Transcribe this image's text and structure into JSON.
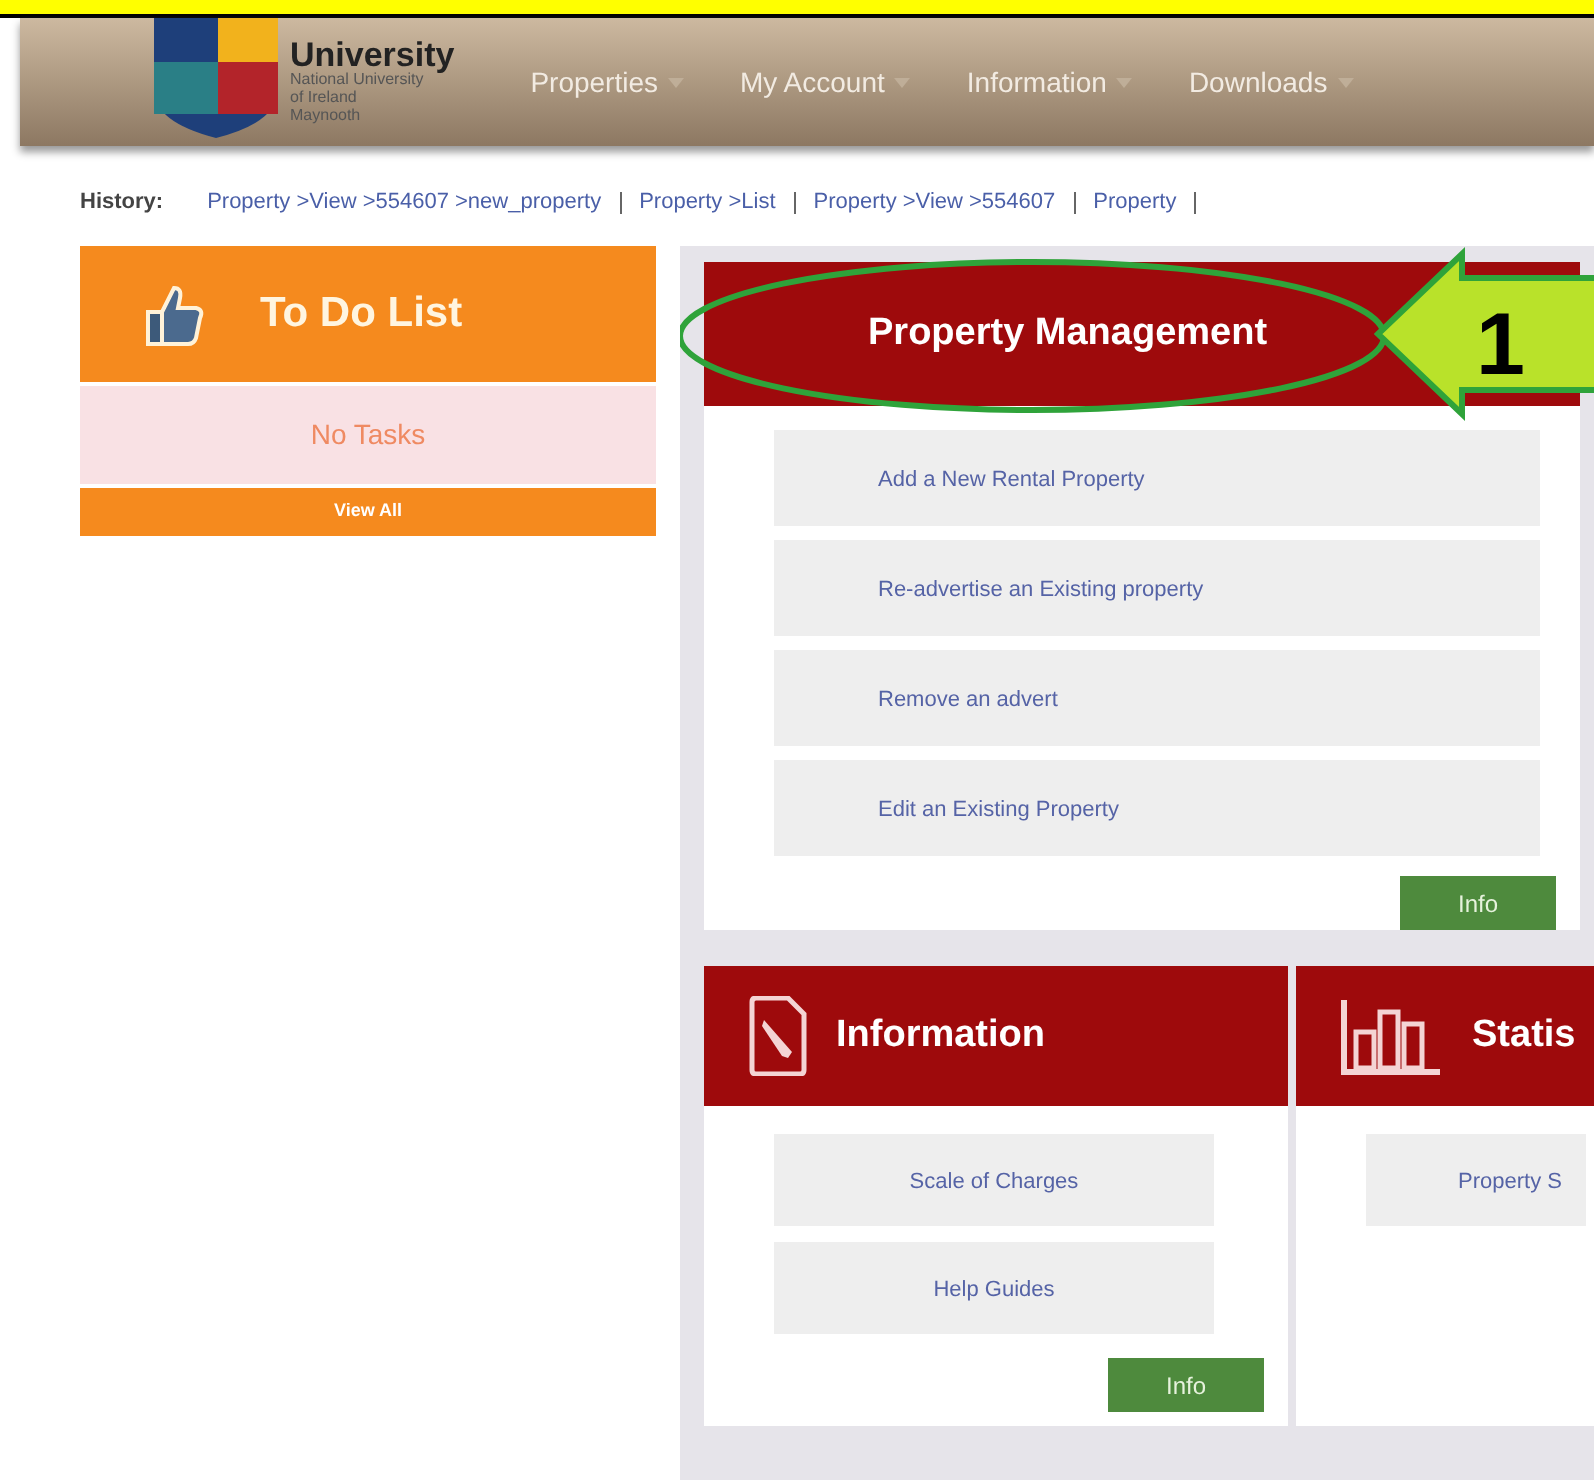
{
  "header": {
    "logo_name": "University",
    "logo_subtitle": "National University of Ireland Maynooth",
    "menu": [
      {
        "label": "Properties",
        "has_dropdown": true
      },
      {
        "label": "My Account",
        "has_dropdown": true
      },
      {
        "label": "Information",
        "has_dropdown": true
      },
      {
        "label": "Downloads",
        "has_dropdown": true
      }
    ]
  },
  "history": {
    "label": "History:",
    "links": [
      "Property >View >554607 >new_property",
      "Property >List",
      "Property >View >554607",
      "Property"
    ]
  },
  "todo": {
    "title": "To Do List",
    "message": "No Tasks",
    "view_all": "View All"
  },
  "property_management": {
    "title": "Property Management",
    "annotation": "1",
    "items": [
      "Add a New Rental Property",
      "Re-advertise an Existing property",
      "Remove an advert",
      "Edit an Existing Property"
    ],
    "button": "Info"
  },
  "panels": [
    {
      "kind": "document",
      "title": "Information",
      "items": [
        "Scale of Charges",
        "Help Guides"
      ],
      "button": "Info"
    },
    {
      "kind": "chart",
      "title": "Statis",
      "items": [
        "Property S"
      ]
    }
  ]
}
